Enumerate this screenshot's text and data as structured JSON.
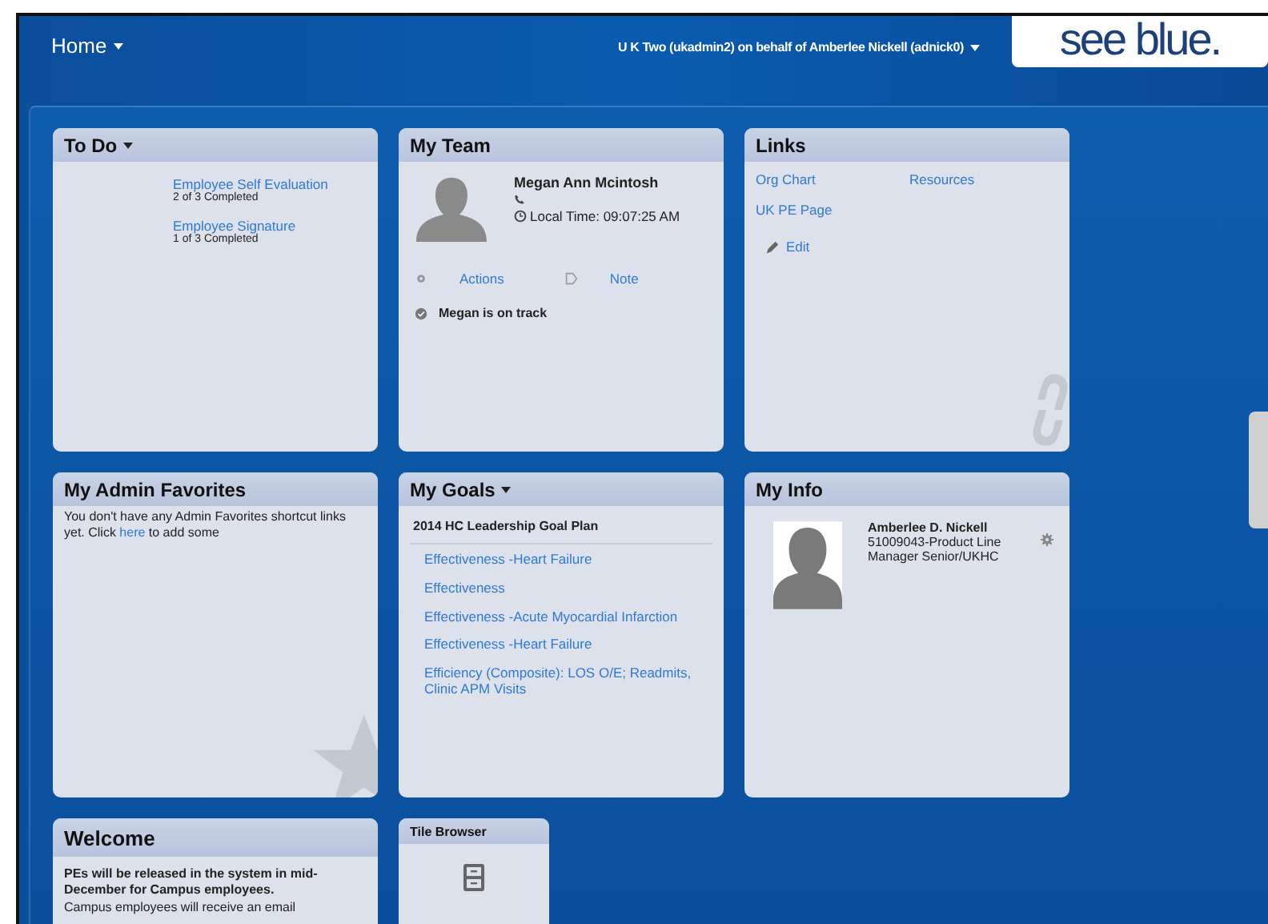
{
  "header": {
    "menu": "Home",
    "user": "U K Two (ukadmin2) on behalf of Amberlee Nickell (adnick0)",
    "logo": "see blue."
  },
  "tiles": [
    {
      "kind": "todo",
      "title": "To Do",
      "has_menu": true,
      "tasks": [
        {
          "name": "Employee Self Evaluation",
          "progress": "2 of 3 Completed"
        },
        {
          "name": "Employee Signature",
          "progress": "1 of 3 Completed"
        }
      ]
    },
    {
      "kind": "team",
      "title": "My Team",
      "has_menu": false,
      "name": "Megan Ann Mcintosh",
      "time": "Local Time: 09:07:25 AM",
      "actions": "Actions",
      "note": "Note",
      "status": "Megan is on track"
    },
    {
      "kind": "links",
      "title": "Links",
      "has_menu": false,
      "links": [
        "Org Chart",
        "Resources",
        "UK PE Page"
      ],
      "edit": "Edit"
    },
    {
      "kind": "favorites",
      "title": "My Admin Favorites",
      "has_menu": false,
      "before": "You don't have any Admin Favorites shortcut links yet. Click",
      "link": "here",
      "after": "to add some"
    },
    {
      "kind": "goals",
      "title": "My Goals",
      "has_menu": true,
      "plan": "2014 HC Leadership Goal Plan",
      "goals": [
        "Effectiveness -Heart Failure",
        "Effectiveness",
        "Effectiveness -Acute Myocardial Infarction",
        "Effectiveness -Heart Failure",
        "Efficiency (Composite): LOS O/E; Readmits, Clinic APM Visits"
      ]
    },
    {
      "kind": "info",
      "title": "My Info",
      "has_menu": false,
      "name": "Amberlee D. Nickell",
      "role": "51009043-Product Line Manager Senior/UKHC"
    },
    {
      "kind": "welcome",
      "title": "Welcome",
      "has_menu": false,
      "bold": "PEs will be released in the system in mid-December for Campus employees.",
      "text": "Campus employees will receive an email"
    },
    {
      "kind": "browser",
      "title": "Tile Browser",
      "has_menu": false
    }
  ]
}
